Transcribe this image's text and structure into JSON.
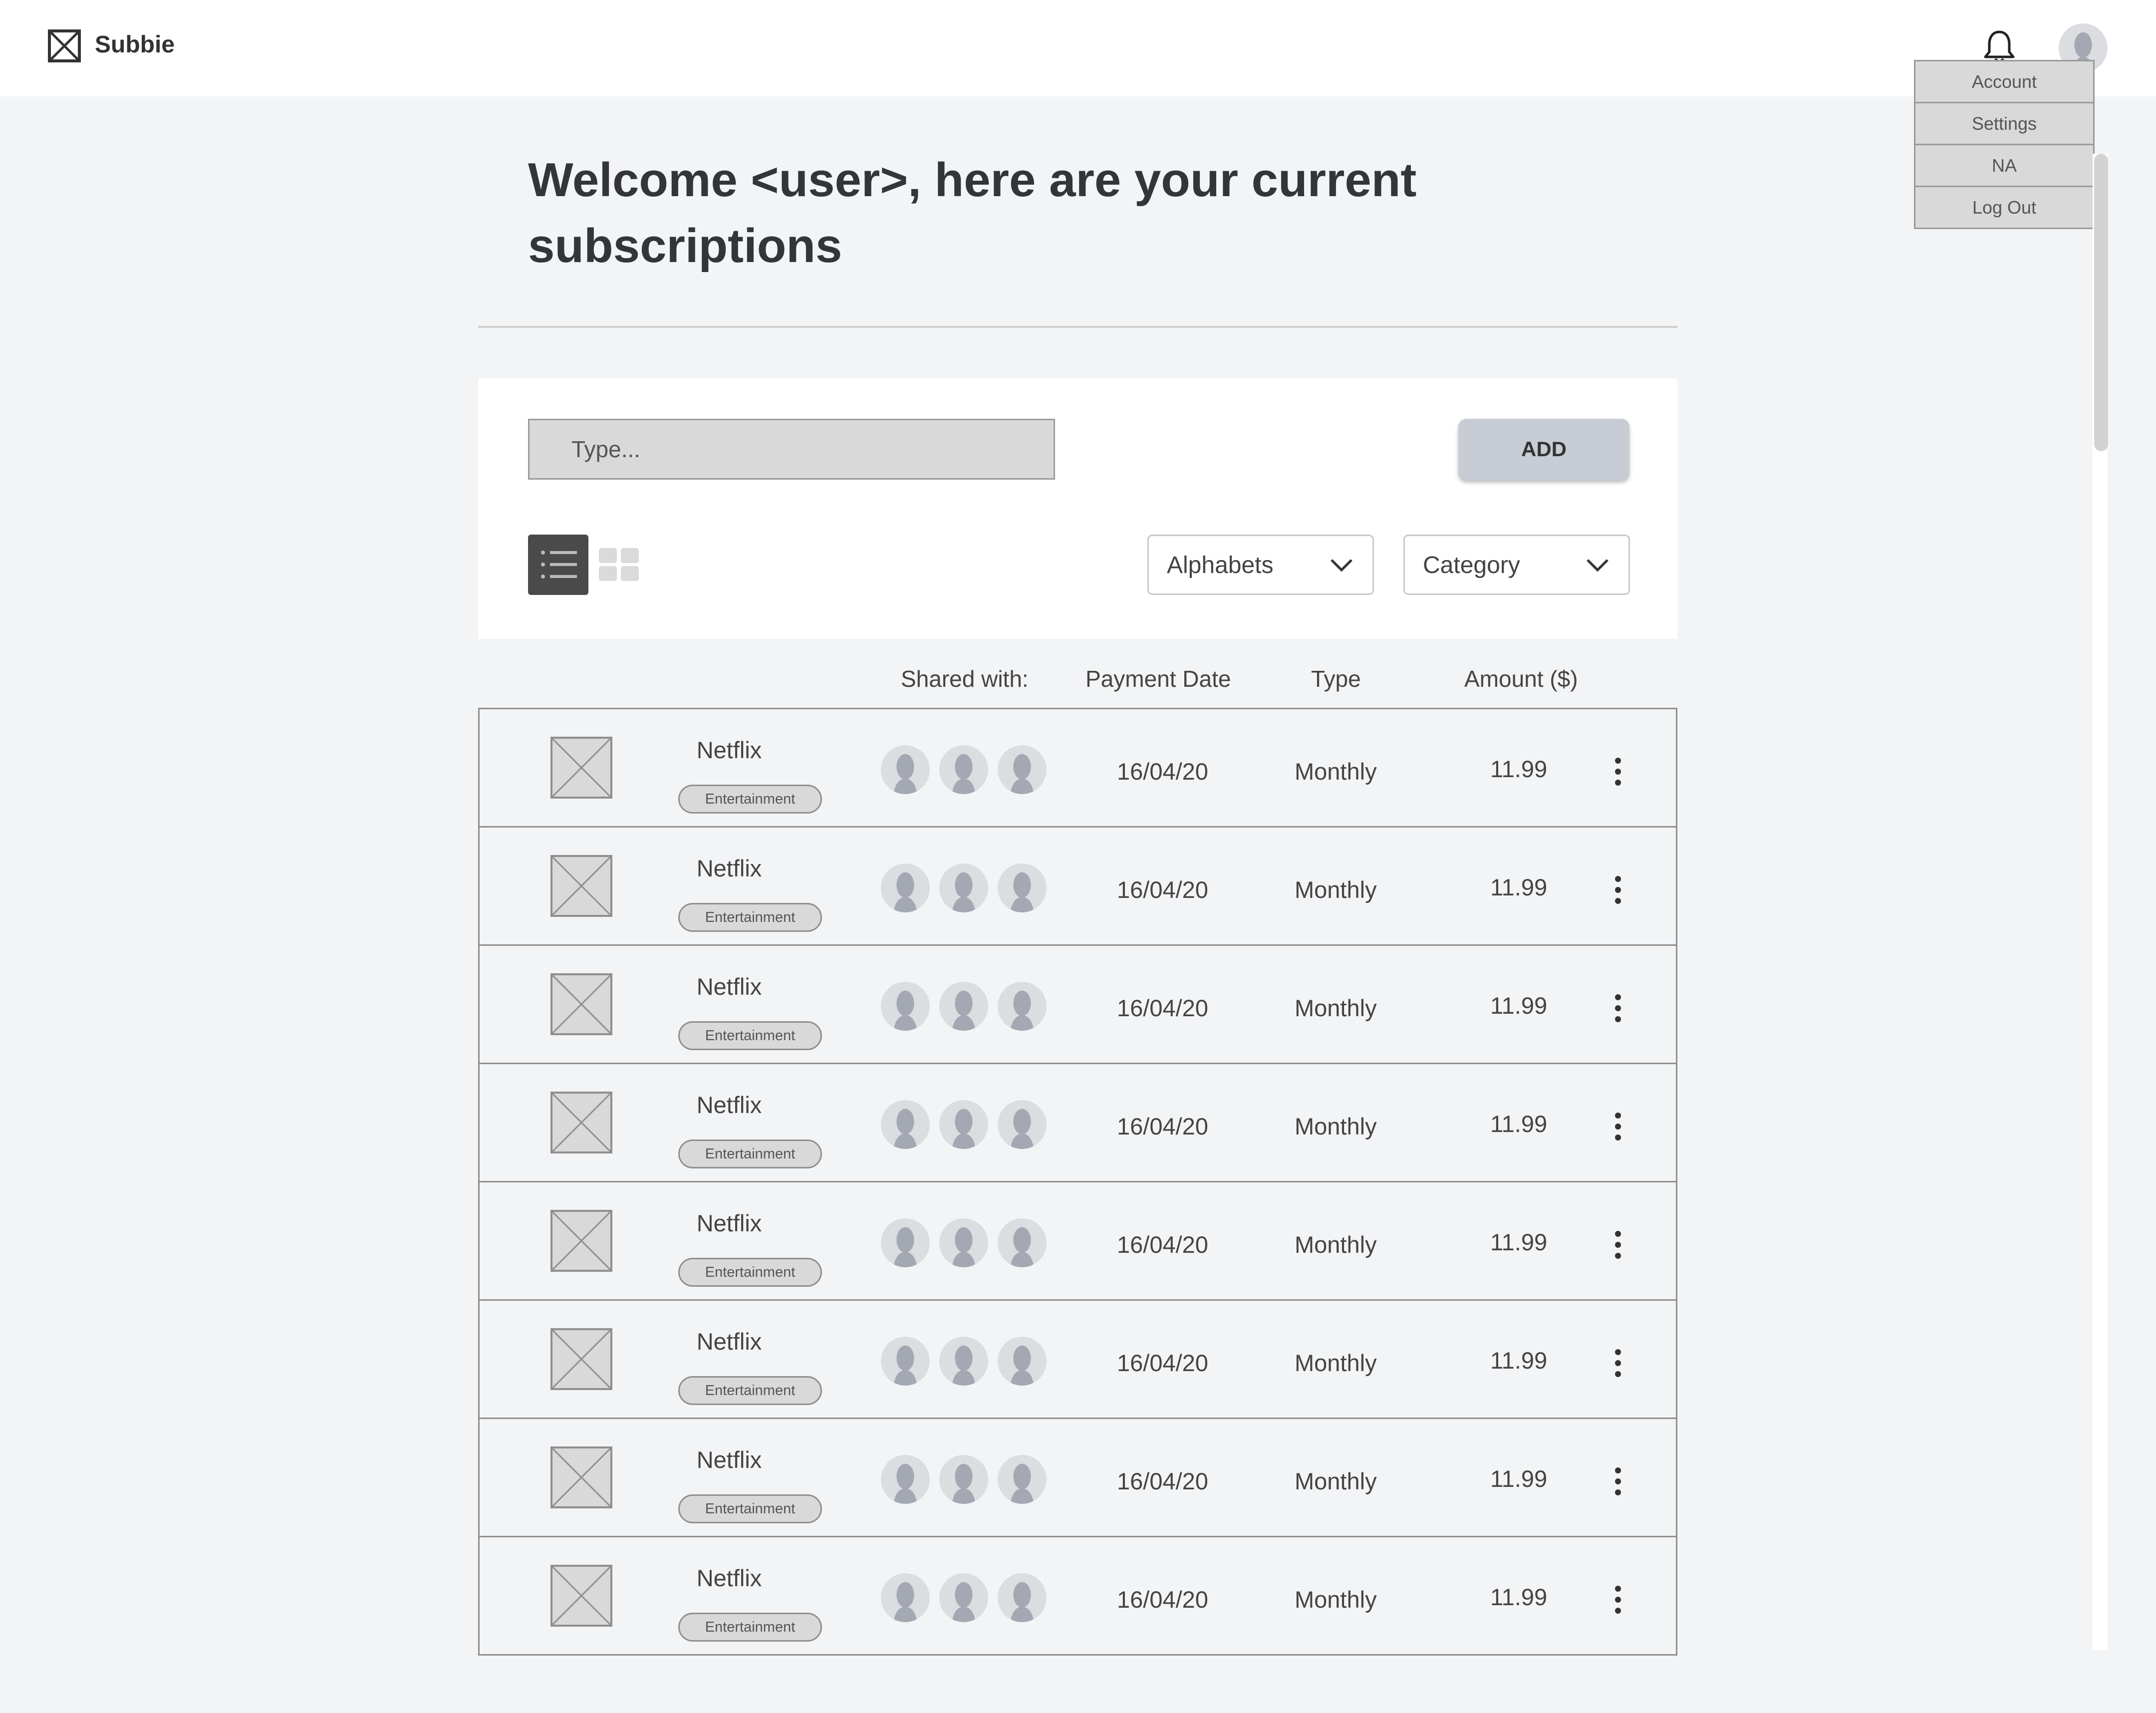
{
  "app": {
    "name": "Subbie"
  },
  "header": {
    "menu": [
      "Account",
      "Settings",
      "NA",
      "Log Out"
    ]
  },
  "page": {
    "title": "Welcome <user>, here are your current subscriptions"
  },
  "controls": {
    "search_placeholder": "Type...",
    "add_label": "ADD",
    "sort_select": "Alphabets",
    "category_select": "Category"
  },
  "table": {
    "headers": {
      "shared": "Shared with:",
      "date": "Payment Date",
      "type": "Type",
      "amount": "Amount ($)"
    },
    "rows": [
      {
        "name": "Netflix",
        "category": "Entertainment",
        "date": "16/04/20",
        "type": "Monthly",
        "amount": "11.99"
      },
      {
        "name": "Netflix",
        "category": "Entertainment",
        "date": "16/04/20",
        "type": "Monthly",
        "amount": "11.99"
      },
      {
        "name": "Netflix",
        "category": "Entertainment",
        "date": "16/04/20",
        "type": "Monthly",
        "amount": "11.99"
      },
      {
        "name": "Netflix",
        "category": "Entertainment",
        "date": "16/04/20",
        "type": "Monthly",
        "amount": "11.99"
      },
      {
        "name": "Netflix",
        "category": "Entertainment",
        "date": "16/04/20",
        "type": "Monthly",
        "amount": "11.99"
      },
      {
        "name": "Netflix",
        "category": "Entertainment",
        "date": "16/04/20",
        "type": "Monthly",
        "amount": "11.99"
      },
      {
        "name": "Netflix",
        "category": "Entertainment",
        "date": "16/04/20",
        "type": "Monthly",
        "amount": "11.99"
      },
      {
        "name": "Netflix",
        "category": "Entertainment",
        "date": "16/04/20",
        "type": "Monthly",
        "amount": "11.99"
      }
    ]
  },
  "icons": {
    "logo": "placeholder-box-icon",
    "notifications": "bell-icon",
    "list_view": "list-view-icon",
    "grid_view": "grid-view-icon",
    "row_actions": "more-vertical-icon"
  },
  "colors": {
    "background": "#f3f4f6",
    "panel": "#ffffff",
    "input_fill": "#d9d9d9",
    "button": "#c8ccd4",
    "active_toggle": "#4a4a4a"
  }
}
